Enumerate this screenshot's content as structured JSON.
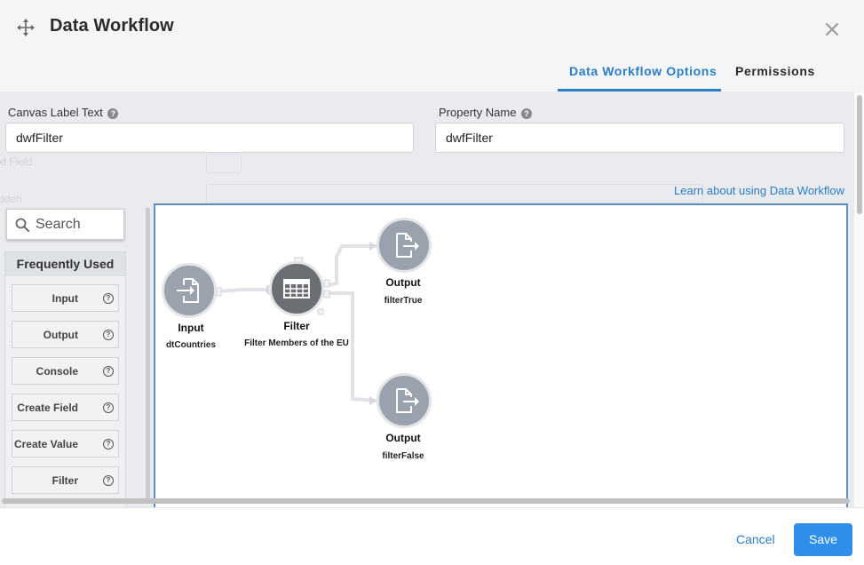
{
  "modal": {
    "title": "Data Workflow",
    "tabs": [
      {
        "label": "Data Workflow Options",
        "active": true
      },
      {
        "label": "Permissions",
        "active": false
      }
    ]
  },
  "fields": {
    "canvas_label": {
      "label": "Canvas Label Text",
      "value": "dwfFilter"
    },
    "property_name": {
      "label": "Property Name",
      "value": "dwfFilter"
    }
  },
  "learn_link": "Learn about using Data Workflow",
  "palette": {
    "search_placeholder": "Search",
    "heading": "Frequently Used",
    "items": [
      "Input",
      "Output",
      "Console",
      "Create Field",
      "Create Value",
      "Filter"
    ]
  },
  "workflow": {
    "nodes": [
      {
        "title": "Input",
        "subtitle": "dtCountries",
        "icon": "input-icon"
      },
      {
        "title": "Filter",
        "subtitle": "Filter Members of the EU",
        "icon": "table-icon"
      },
      {
        "title": "Output",
        "subtitle": "filterTrue",
        "icon": "output-icon"
      },
      {
        "title": "Output",
        "subtitle": "filterFalse",
        "icon": "output-icon"
      }
    ]
  },
  "footer": {
    "cancel": "Cancel",
    "save": "Save"
  },
  "colors": {
    "accent": "#2a7ec5",
    "save_button": "#2f8fe8",
    "node_light": "#9aa3ad",
    "node_dark": "#6b6e72"
  }
}
